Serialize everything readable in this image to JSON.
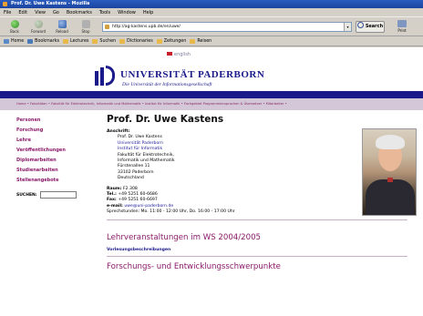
{
  "window": {
    "title": "Prof. Dr. Uwe Kastens - Mozilla"
  },
  "menu": [
    "File",
    "Edit",
    "View",
    "Go",
    "Bookmarks",
    "Tools",
    "Window",
    "Help"
  ],
  "nav": {
    "back": "Back",
    "forward": "Forward",
    "reload": "Reload",
    "stop": "Stop",
    "url": "http://ag-kastens.upb.de/en/uwe/",
    "search": "Search",
    "print": "Print"
  },
  "bookmarks": [
    "Home",
    "Bookmarks",
    "Lectures",
    "Suchen",
    "Dictionaries",
    "Zeitungen",
    "Reisen"
  ],
  "header": {
    "english": "english",
    "university": "UNIVERSITÄT PADERBORN",
    "tagline": "Die Universität der Informationsgesellschaft"
  },
  "breadcrumb": "Home • Fakultäten • Fakultät für Elektrotechnik, Informatik und Mathematik • Institut für Informatik • Fachgebiet Programmiersprachen & Übersetzer • Mitarbeiter •",
  "sidebar": {
    "items": [
      "Personen",
      "Forschung",
      "Lehre",
      "Veröffentlichungen",
      "Diplomarbeiten",
      "Studienarbeiten",
      "Stellenangebote"
    ],
    "search_label": "SUCHEN:"
  },
  "main": {
    "name": "Prof. Dr. Uwe Kastens",
    "address_label": "Anschrift:",
    "address": [
      "Prof. Dr. Uwe Kastens",
      "Universität Paderborn",
      "Institut für Informatik",
      "Fakultät für Elektrotechnik,",
      "Informatik und Mathematik",
      "Fürstenallee 11",
      "33102 Paderborn",
      "Deutschland"
    ],
    "room_label": "Raum:",
    "room": "F2.308",
    "tel_label": "Tel.:",
    "tel": "+49 5251 60-6686",
    "fax_label": "Fax:",
    "fax": "+49 5251 60-6697",
    "email_label": "e-mail:",
    "email": "uwe@uni-paderborn.de",
    "hours": "Sprechstunden: Mo. 11:00 - 12:00 Uhr, Do. 16:00 - 17:00 Uhr",
    "section1": "Lehrveranstaltungen im WS 2004/2005",
    "section1_link": "Vorlesungsbeschreibungen",
    "section2": "Forschungs- und Entwicklungsschwerpunkte"
  }
}
